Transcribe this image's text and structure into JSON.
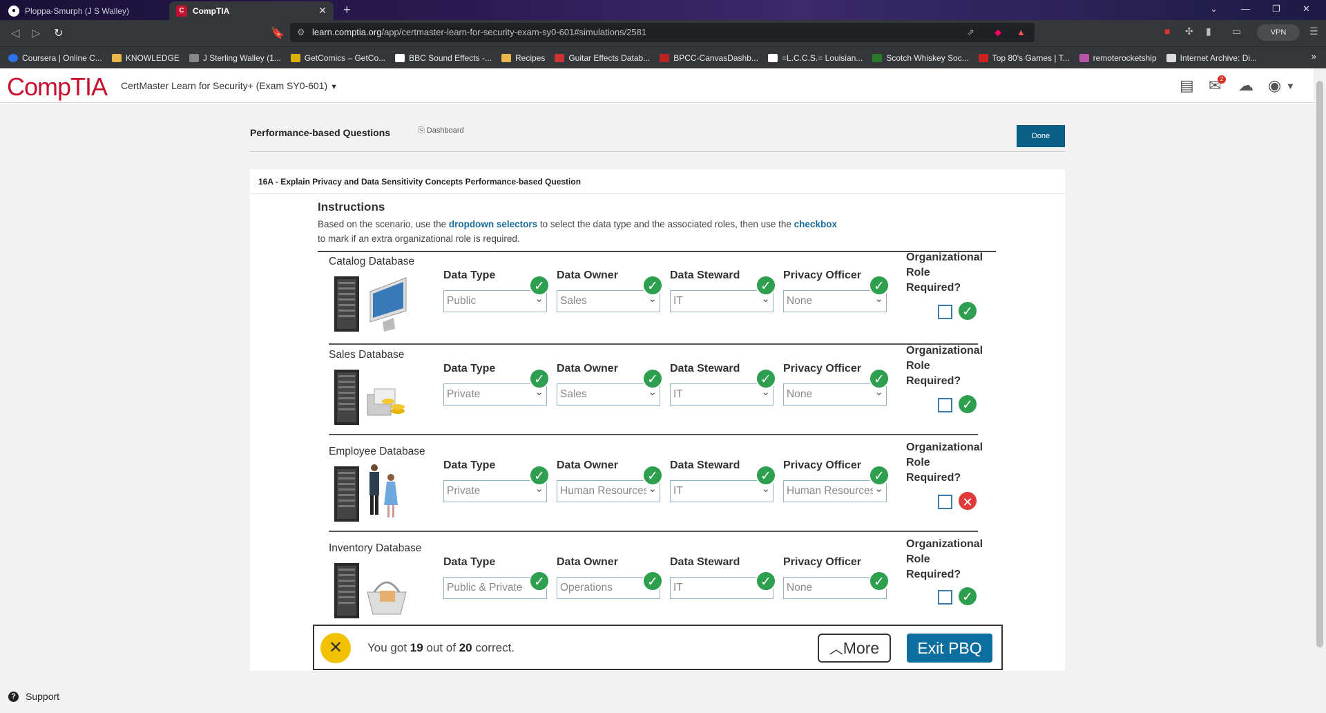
{
  "browser": {
    "tabs": [
      {
        "label": "Ploppa-Smurph (J S Walley)",
        "active": false
      },
      {
        "label": "CompTIA",
        "active": true
      }
    ],
    "url_host": "learn.comptia.org",
    "url_path": "/app/certmaster-learn-for-security-exam-sy0-601#simulations/2581",
    "vpn_label": "VPN",
    "bookmarks": [
      "Coursera | Online C...",
      "KNOWLEDGE",
      "J Sterling Walley (1...",
      "GetComics – GetCo...",
      "BBC Sound Effects -...",
      "Recipes",
      "Guitar Effects Datab...",
      "BPCC-CanvasDashb...",
      "=L.C.C.S.= Louisian...",
      "Scotch Whiskey Soc...",
      "Top 80's Games | T...",
      "remoterocketship",
      "Internet Archive: Di..."
    ]
  },
  "app": {
    "logo": "CompTIA",
    "course": "CertMaster Learn for Security+ (Exam SY0-601)",
    "mail_badge": "2"
  },
  "page": {
    "title": "Performance-based Questions",
    "dashboard_link": "Dashboard",
    "done_label": "Done",
    "panel_title": "16A - Explain Privacy and Data Sensitivity Concepts Performance-based Question",
    "instructions_title": "Instructions",
    "instr_part1": "Based on the scenario, use the ",
    "instr_bold1": "dropdown selectors",
    "instr_part2": " to select the data type and the associated roles, then use the ",
    "instr_bold2": "checkbox",
    "instr_part3": " to mark if an extra organizational role is required."
  },
  "labels": {
    "data_type": "Data Type",
    "data_owner": "Data Owner",
    "data_steward": "Data Steward",
    "privacy_officer": "Privacy Officer",
    "org_role_line1": "Organizational",
    "org_role_line2": "Role Required?"
  },
  "databases": [
    {
      "name": "Catalog Database",
      "data_type": "Public",
      "data_owner": "Sales",
      "data_steward": "IT",
      "privacy_officer": "None",
      "org_role_checked": false,
      "org_role_correct": true
    },
    {
      "name": "Sales Database",
      "data_type": "Private",
      "data_owner": "Sales",
      "data_steward": "IT",
      "privacy_officer": "None",
      "org_role_checked": false,
      "org_role_correct": true
    },
    {
      "name": "Employee Database",
      "data_type": "Private",
      "data_owner": "Human Resources",
      "data_steward": "IT",
      "privacy_officer": "Human Resources",
      "org_role_checked": false,
      "org_role_correct": false
    },
    {
      "name": "Inventory Database",
      "data_type": "Public & Private",
      "data_owner": "Operations",
      "data_steward": "IT",
      "privacy_officer": "None",
      "org_role_checked": false,
      "org_role_correct": true
    }
  ],
  "result": {
    "prefix": "You got ",
    "score": "19",
    "middle": " out of ",
    "total": "20",
    "suffix": " correct.",
    "more_label": "More",
    "exit_label": "Exit PBQ"
  },
  "footer": {
    "support": "Support"
  },
  "colors": {
    "brand_red": "#c8102e",
    "correct_green": "#2e9e4f",
    "wrong_red": "#e03a3a",
    "primary_blue": "#0b5e86"
  }
}
